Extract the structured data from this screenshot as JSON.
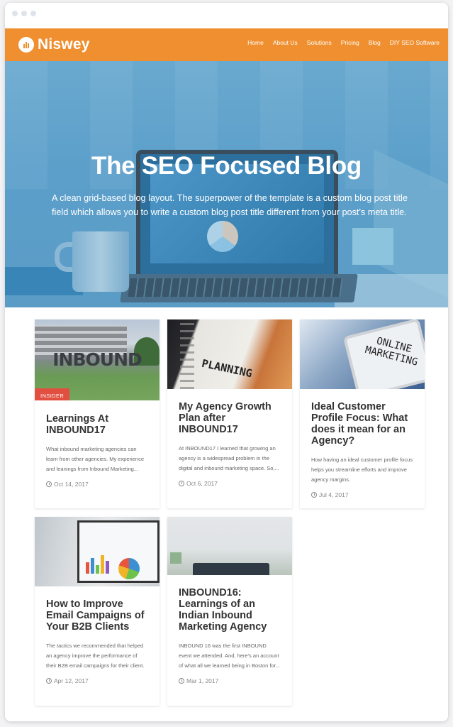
{
  "brand": {
    "name": "Niswey",
    "accent": "#ef8f2f"
  },
  "nav": {
    "items": [
      "Home",
      "About Us",
      "Solutions",
      "Pricing",
      "Blog",
      "DIY SEO Software"
    ]
  },
  "hero": {
    "title": "The SEO Focused Blog",
    "subtitle": "A clean grid-based blog layout. The superpower of the template is a custom blog post title field which allows you to write a custom blog post title different from your post's meta title."
  },
  "posts": [
    {
      "tag": "INSIDER",
      "thumb_text": "INBOUND",
      "title": "Learnings At INBOUND17",
      "excerpt": "What inbound marketing agencies can learn from other agencies. My experience and leanings from Inbound Marketing...",
      "date": "Oct 14, 2017"
    },
    {
      "thumb_text": "PLANNING",
      "title": "My Agency Growth Plan after INBOUND17",
      "excerpt": "At INBOUND17 I learned that growing an agency is a widespread problem in the digital and inbound marketing space. So,...",
      "date": "Oct 6, 2017"
    },
    {
      "thumb_text": "ONLINE MARKETING",
      "title": "Ideal Customer Profile Focus: What does it mean for an Agency?",
      "excerpt": "How having an ideal customer profile focus helps you streamline efforts and improve agency margins.",
      "date": "Jul 4, 2017"
    },
    {
      "title": "How to Improve Email Campaigns of Your B2B Clients",
      "excerpt": "The tactics we recommended that helped an agency improve the performance of their B2B email campaigns for their client.",
      "date": "Apr 12, 2017"
    },
    {
      "title": "INBOUND16: Learnings of an Indian Inbound Marketing Agency",
      "excerpt": "INBOUND 16 was the first INBOUND event we attended. And, here's an account of what all we learned being in Boston for...",
      "date": "Mar 1, 2017"
    }
  ]
}
